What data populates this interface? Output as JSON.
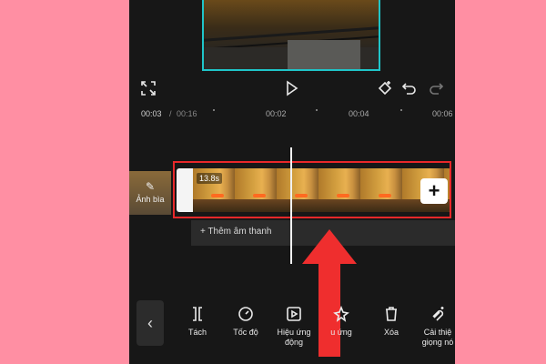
{
  "timeline": {
    "current_time": "00:03",
    "separator": "/",
    "total_time": "00:16",
    "ticks": [
      "00:02",
      "00:04",
      "00:06"
    ]
  },
  "cover": {
    "label": "Ảnh bìa"
  },
  "clip": {
    "duration": "13.8s",
    "add_label": "+"
  },
  "audio": {
    "label": "+ Thêm âm thanh"
  },
  "toolbar": {
    "back_label": "‹",
    "items": [
      {
        "label": "Tách",
        "icon": "split-icon"
      },
      {
        "label": "Tốc độ",
        "icon": "speed-icon"
      },
      {
        "label": "Hiệu ứng động",
        "icon": "animation-icon"
      },
      {
        "label": "u ứng",
        "icon": "effects-icon"
      },
      {
        "label": "Xóa",
        "icon": "trash-icon"
      },
      {
        "label": "Cải thiệ giọng nó",
        "icon": "voice-enhance-icon"
      }
    ]
  },
  "colors": {
    "accent_cyan": "#1fc5c9",
    "highlight_red": "#e8282a",
    "background_pink": "#ff8fa3"
  }
}
